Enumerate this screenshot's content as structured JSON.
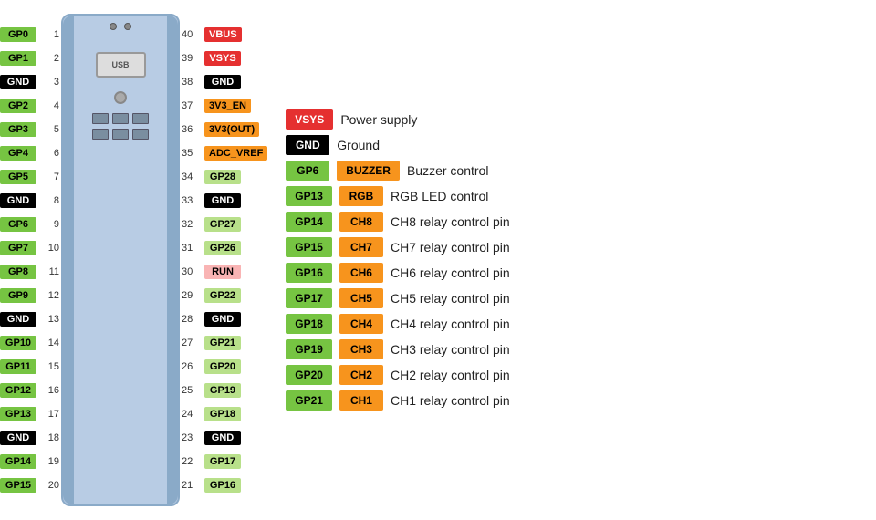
{
  "left_pins": [
    {
      "label": "GP0",
      "color": "green",
      "number": "1"
    },
    {
      "label": "GP1",
      "color": "green",
      "number": "2"
    },
    {
      "label": "GND",
      "color": "black",
      "number": "3"
    },
    {
      "label": "GP2",
      "color": "green",
      "number": "4"
    },
    {
      "label": "GP3",
      "color": "green",
      "number": "5"
    },
    {
      "label": "GP4",
      "color": "green",
      "number": "6"
    },
    {
      "label": "GP5",
      "color": "green",
      "number": "7"
    },
    {
      "label": "GND",
      "color": "black",
      "number": "8"
    },
    {
      "label": "GP6",
      "color": "green",
      "number": "9"
    },
    {
      "label": "GP7",
      "color": "green",
      "number": "10"
    },
    {
      "label": "GP8",
      "color": "green",
      "number": "11"
    },
    {
      "label": "GP9",
      "color": "green",
      "number": "12"
    },
    {
      "label": "GND",
      "color": "black",
      "number": "13"
    },
    {
      "label": "GP10",
      "color": "green",
      "number": "14"
    },
    {
      "label": "GP11",
      "color": "green",
      "number": "15"
    },
    {
      "label": "GP12",
      "color": "green",
      "number": "16"
    },
    {
      "label": "GP13",
      "color": "green",
      "number": "17"
    },
    {
      "label": "GND",
      "color": "black",
      "number": "18"
    },
    {
      "label": "GP14",
      "color": "green",
      "number": "19"
    },
    {
      "label": "GP15",
      "color": "green",
      "number": "20"
    }
  ],
  "right_pins": [
    {
      "label": "VBUS",
      "color": "red",
      "number": "40"
    },
    {
      "label": "VSYS",
      "color": "red",
      "number": "39"
    },
    {
      "label": "GND",
      "color": "black",
      "number": "38"
    },
    {
      "label": "3V3_EN",
      "color": "orange",
      "number": "37"
    },
    {
      "label": "3V3(OUT)",
      "color": "orange",
      "number": "36"
    },
    {
      "label": "ADC_VREF",
      "color": "orange",
      "number": "35"
    },
    {
      "label": "GP28",
      "color": "light-green",
      "number": "34"
    },
    {
      "label": "GND",
      "color": "black",
      "number": "33"
    },
    {
      "label": "GP27",
      "color": "light-green",
      "number": "32"
    },
    {
      "label": "GP26",
      "color": "light-green",
      "number": "31"
    },
    {
      "label": "RUN",
      "color": "pink",
      "number": "30"
    },
    {
      "label": "GP22",
      "color": "light-green",
      "number": "29"
    },
    {
      "label": "GND",
      "color": "black",
      "number": "28"
    },
    {
      "label": "GP21",
      "color": "light-green",
      "number": "27"
    },
    {
      "label": "GP20",
      "color": "light-green",
      "number": "26"
    },
    {
      "label": "GP19",
      "color": "light-green",
      "number": "25"
    },
    {
      "label": "GP18",
      "color": "light-green",
      "number": "24"
    },
    {
      "label": "GND",
      "color": "black",
      "number": "23"
    },
    {
      "label": "GP17",
      "color": "light-green",
      "number": "22"
    },
    {
      "label": "GP16",
      "color": "light-green",
      "number": "21"
    }
  ],
  "legend": [
    {
      "chip1": {
        "label": "VSYS",
        "color": "red"
      },
      "chip2": null,
      "description": "Power supply"
    },
    {
      "chip1": {
        "label": "GND",
        "color": "black"
      },
      "chip2": null,
      "description": "Ground"
    },
    {
      "chip1": {
        "label": "GP6",
        "color": "green"
      },
      "chip2": {
        "label": "BUZZER",
        "color": "orange"
      },
      "description": "Buzzer control"
    },
    {
      "chip1": {
        "label": "GP13",
        "color": "green"
      },
      "chip2": {
        "label": "RGB",
        "color": "orange"
      },
      "description": "RGB LED control"
    },
    {
      "chip1": {
        "label": "GP14",
        "color": "green"
      },
      "chip2": {
        "label": "CH8",
        "color": "orange"
      },
      "description": "CH8 relay control pin"
    },
    {
      "chip1": {
        "label": "GP15",
        "color": "green"
      },
      "chip2": {
        "label": "CH7",
        "color": "orange"
      },
      "description": "CH7 relay control pin"
    },
    {
      "chip1": {
        "label": "GP16",
        "color": "green"
      },
      "chip2": {
        "label": "CH6",
        "color": "orange"
      },
      "description": "CH6 relay control pin"
    },
    {
      "chip1": {
        "label": "GP17",
        "color": "green"
      },
      "chip2": {
        "label": "CH5",
        "color": "orange"
      },
      "description": "CH5 relay control pin"
    },
    {
      "chip1": {
        "label": "GP18",
        "color": "green"
      },
      "chip2": {
        "label": "CH4",
        "color": "orange"
      },
      "description": "CH4 relay control pin"
    },
    {
      "chip1": {
        "label": "GP19",
        "color": "green"
      },
      "chip2": {
        "label": "CH3",
        "color": "orange"
      },
      "description": "CH3 relay control pin"
    },
    {
      "chip1": {
        "label": "GP20",
        "color": "green"
      },
      "chip2": {
        "label": "CH2",
        "color": "orange"
      },
      "description": "CH2 relay control pin"
    },
    {
      "chip1": {
        "label": "GP21",
        "color": "green"
      },
      "chip2": {
        "label": "CH1",
        "color": "orange"
      },
      "description": "CH1 relay control pin"
    }
  ]
}
